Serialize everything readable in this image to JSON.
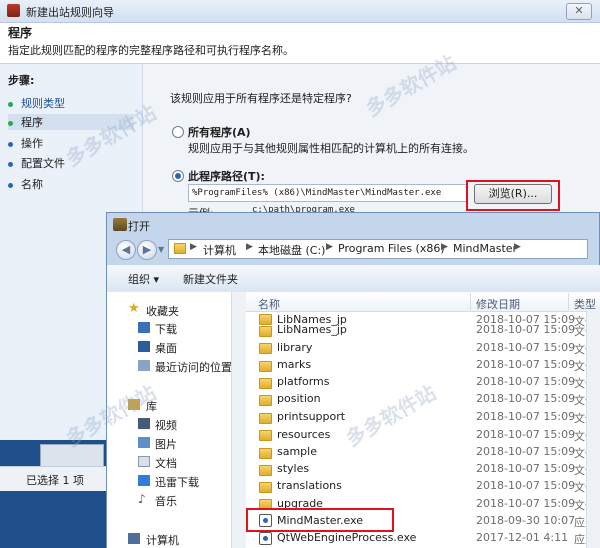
{
  "wizard": {
    "title": "新建出站规则向导",
    "close_label": "✕",
    "heading": "程序",
    "description": "指定此规则匹配的程序的完整程序路径和可执行程序名称。",
    "steps_title": "步骤:",
    "steps": [
      {
        "label": "规则类型",
        "color": "#2aa84a"
      },
      {
        "label": "程序",
        "color": "#2aa84a"
      },
      {
        "label": "操作",
        "color": "#2a66b8"
      },
      {
        "label": "配置文件",
        "color": "#2a66b8"
      },
      {
        "label": "名称",
        "color": "#2a66b8"
      }
    ],
    "question": "该规则应用于所有程序还是特定程序?",
    "option_all_title": "所有程序(A)",
    "option_all_desc": "规则应用于与其他规则属性相匹配的计算机上的所有连接。",
    "option_path_title": "此程序路径(T):",
    "path_value": "%ProgramFiles% (x86)\\MindMaster\\MindMaster.exe",
    "browse_label": "浏览(R)...",
    "example_label": "示例:",
    "example_value": "c:\\path\\program.exe",
    "selected_status": "已选择 1 项"
  },
  "dialog": {
    "title": "打开",
    "breadcrumbs": [
      "计算机",
      "本地磁盘 (C:)",
      "Program Files (x86)",
      "MindMaster"
    ],
    "toolbar": {
      "organize": "组织 ▾",
      "new_folder": "新建文件夹"
    },
    "nav": {
      "favorites": "收藏夹",
      "favorites_items": [
        "下载",
        "桌面",
        "最近访问的位置"
      ],
      "libraries": "库",
      "library_items": [
        "视频",
        "图片",
        "文档",
        "迅雷下载",
        "音乐"
      ],
      "computer": "计算机"
    },
    "columns": {
      "name": "名称",
      "date": "修改日期",
      "type": "类型"
    },
    "files": [
      {
        "name": "LibNames_jp",
        "date": "2018-10-07 15:09",
        "type": "文件",
        "kind": "folder"
      },
      {
        "name": "library",
        "date": "2018-10-07 15:09",
        "type": "文件",
        "kind": "folder"
      },
      {
        "name": "marks",
        "date": "2018-10-07 15:09",
        "type": "文件",
        "kind": "folder"
      },
      {
        "name": "platforms",
        "date": "2018-10-07 15:09",
        "type": "文件",
        "kind": "folder"
      },
      {
        "name": "position",
        "date": "2018-10-07 15:09",
        "type": "文件",
        "kind": "folder"
      },
      {
        "name": "printsupport",
        "date": "2018-10-07 15:09",
        "type": "文件",
        "kind": "folder"
      },
      {
        "name": "resources",
        "date": "2018-10-07 15:09",
        "type": "文件",
        "kind": "folder"
      },
      {
        "name": "sample",
        "date": "2018-10-07 15:09",
        "type": "文件",
        "kind": "folder"
      },
      {
        "name": "styles",
        "date": "2018-10-07 15:09",
        "type": "文件",
        "kind": "folder"
      },
      {
        "name": "translations",
        "date": "2018-10-07 15:09",
        "type": "文件",
        "kind": "folder"
      },
      {
        "name": "upgrade",
        "date": "2018-10-07 15:09",
        "type": "文件",
        "kind": "folder"
      },
      {
        "name": "MindMaster.exe",
        "date": "2018-09-30 10:07",
        "type": "应用程",
        "kind": "exe"
      },
      {
        "name": "QtWebEngineProcess.exe",
        "date": "2017-12-01 4:11",
        "type": "应用程",
        "kind": "exe"
      }
    ]
  },
  "watermark": "多多软件站"
}
